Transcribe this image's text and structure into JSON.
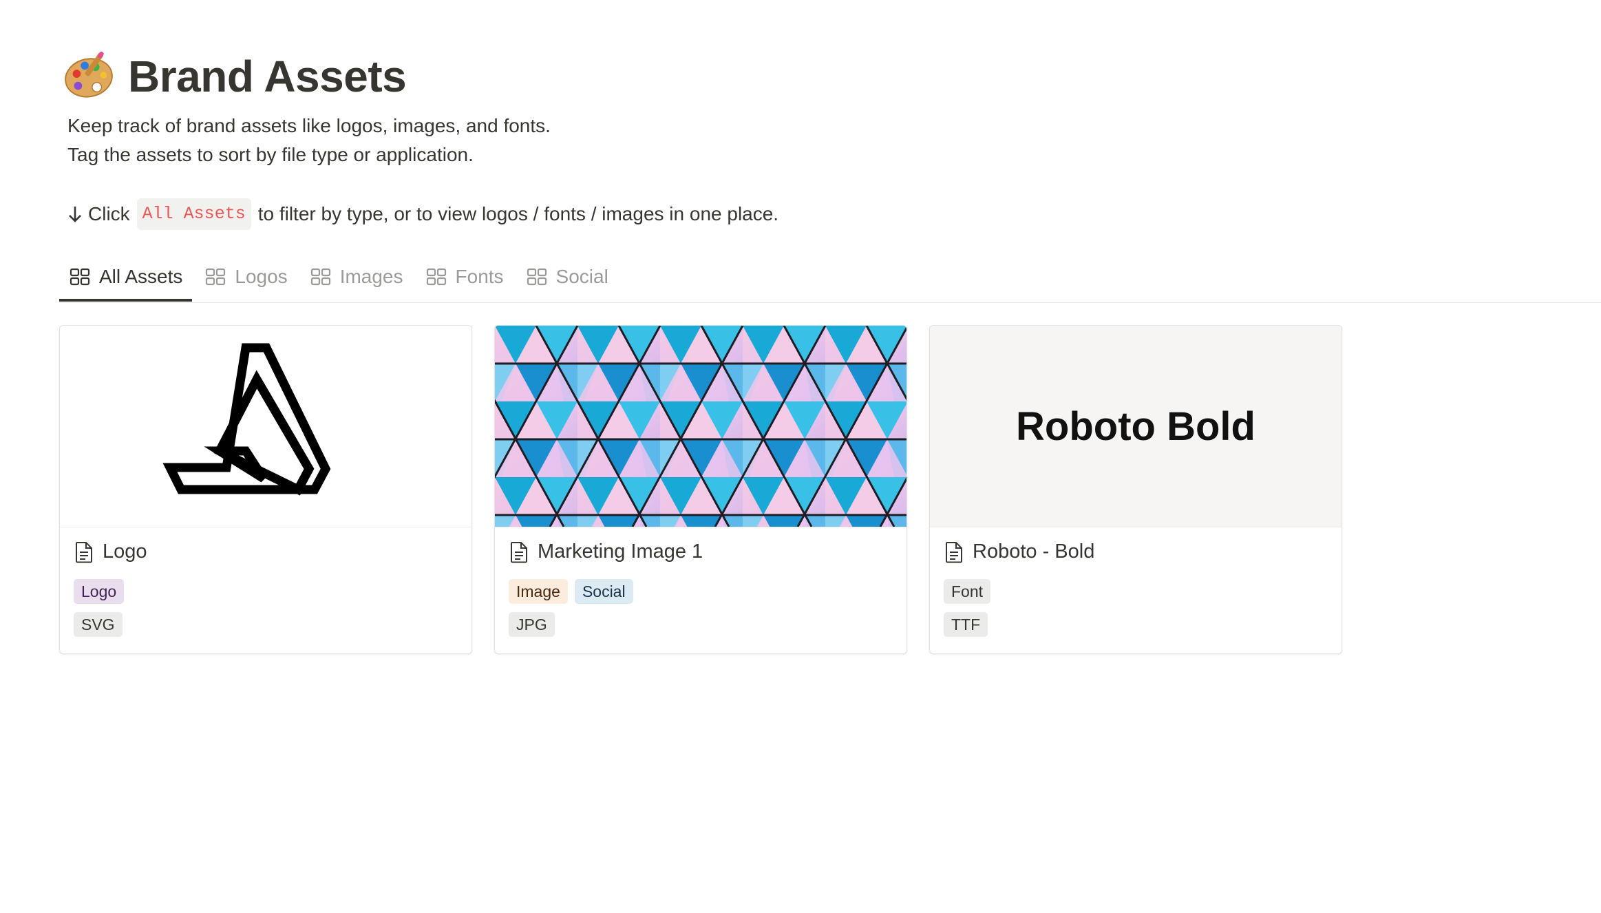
{
  "page": {
    "icon": "artist-palette-icon",
    "title": "Brand Assets",
    "description_lines": [
      "Keep track of brand assets like logos, images, and fonts.",
      "Tag the assets to sort by file type or application."
    ],
    "instruction": {
      "prefix": "Click",
      "code": "All Assets",
      "suffix": "to filter by type, or to view logos / fonts / images in one place."
    }
  },
  "tabs": [
    {
      "label": "All Assets",
      "active": true,
      "icon": "gallery-grid-icon"
    },
    {
      "label": "Logos",
      "active": false,
      "icon": "gallery-grid-icon"
    },
    {
      "label": "Images",
      "active": false,
      "icon": "gallery-grid-icon"
    },
    {
      "label": "Fonts",
      "active": false,
      "icon": "gallery-grid-icon"
    },
    {
      "label": "Social",
      "active": false,
      "icon": "gallery-grid-icon"
    }
  ],
  "cards": [
    {
      "title": "Logo",
      "cover": "penrose-triangle-logo",
      "tags": [
        {
          "label": "Logo",
          "bg": "#e8deee",
          "fg": "#412454"
        }
      ],
      "file_type": {
        "label": "SVG",
        "bg": "#ebebea",
        "fg": "#37352f"
      }
    },
    {
      "title": "Marketing Image 1",
      "cover": "geometric-triangle-pattern-photo",
      "tags": [
        {
          "label": "Image",
          "bg": "#fbecdd",
          "fg": "#49290e"
        },
        {
          "label": "Social",
          "bg": "#dbeaf3",
          "fg": "#183347"
        }
      ],
      "file_type": {
        "label": "JPG",
        "bg": "#ebebea",
        "fg": "#37352f"
      }
    },
    {
      "title": "Roboto - Bold",
      "cover_text": "Roboto Bold",
      "tags": [
        {
          "label": "Font",
          "bg": "#ebebea",
          "fg": "#37352f"
        }
      ],
      "file_type": {
        "label": "TTF",
        "bg": "#ebebea",
        "fg": "#37352f"
      }
    }
  ]
}
